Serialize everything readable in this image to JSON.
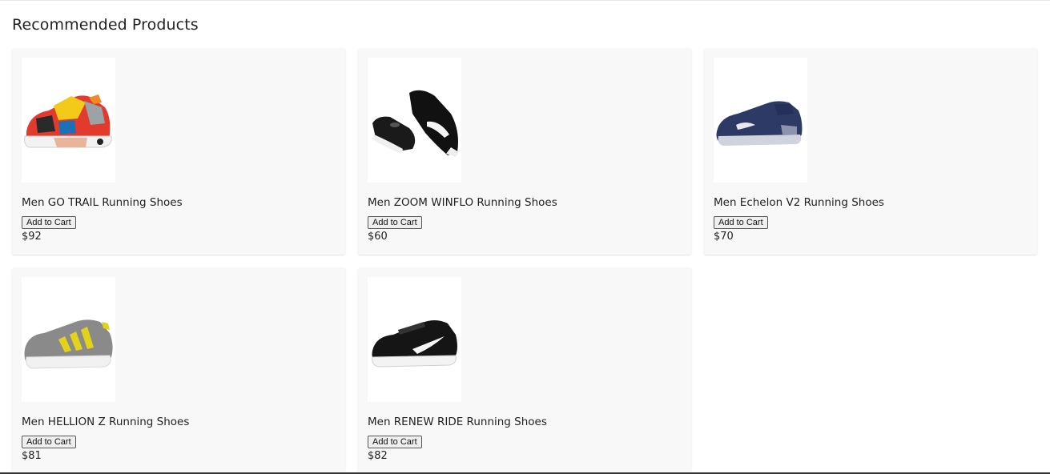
{
  "section": {
    "title": "Recommended Products"
  },
  "products": [
    {
      "name": "Men GO TRAIL Running Shoes",
      "button": "Add to Cart",
      "price": "$92",
      "image": "multicolor-trail-shoe"
    },
    {
      "name": "Men ZOOM WINFLO Running Shoes",
      "button": "Add to Cart",
      "price": "$60",
      "image": "black-running-shoe-pair"
    },
    {
      "name": "Men Echelon V2 Running Shoes",
      "button": "Add to Cart",
      "price": "$70",
      "image": "navy-running-shoe"
    },
    {
      "name": "Men HELLION Z Running Shoes",
      "button": "Add to Cart",
      "price": "$81",
      "image": "grey-yellow-running-shoe"
    },
    {
      "name": "Men RENEW RIDE Running Shoes",
      "button": "Add to Cart",
      "price": "$82",
      "image": "black-white-running-shoe"
    }
  ]
}
